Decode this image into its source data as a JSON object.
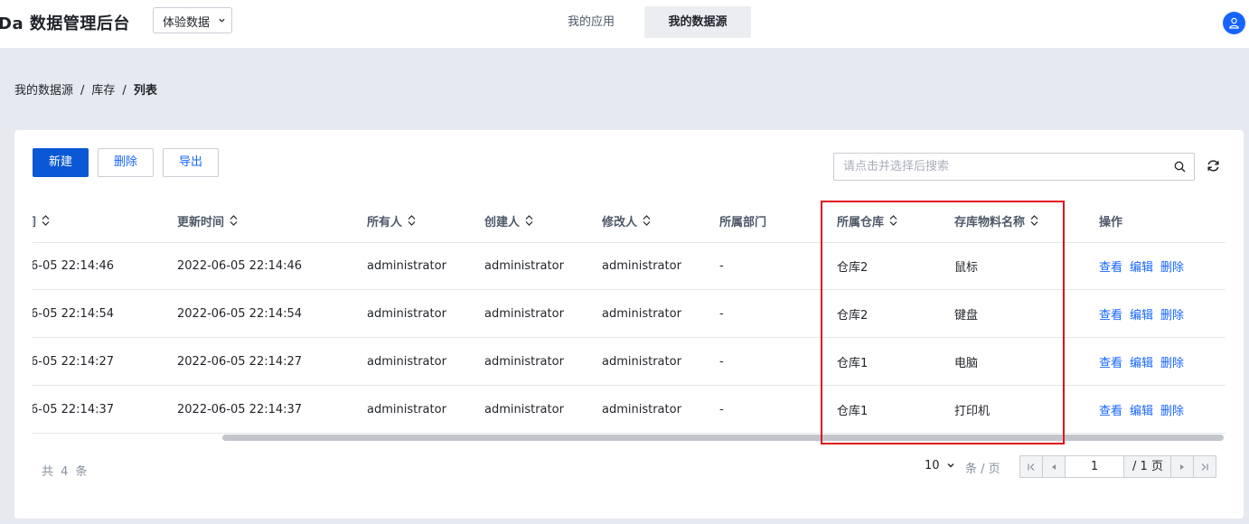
{
  "app": {
    "title": "Da 数据管理后台",
    "env_selected": "体验数据",
    "nav": [
      {
        "label": "我的应用",
        "active": false
      },
      {
        "label": "我的数据源",
        "active": true
      }
    ],
    "avatar_icon": "user-icon"
  },
  "breadcrumb": [
    "我的数据源",
    "库存",
    "列表"
  ],
  "breadcrumb_sep": "/",
  "toolbar": {
    "new_label": "新建",
    "delete_label": "删除",
    "export_label": "导出"
  },
  "search": {
    "placeholder": "请点击并选择后搜索"
  },
  "table": {
    "columns": [
      "间",
      "更新时间",
      "所有人",
      "创建人",
      "修改人",
      "所属部门",
      "所属仓库",
      "存库物料名称",
      "操作"
    ],
    "rows": [
      {
        "created": "6-05 22:14:46",
        "updated": "2022-06-05 22:14:46",
        "owner": "administrator",
        "creator": "administrator",
        "modifier": "administrator",
        "dept": "-",
        "warehouse": "仓库2",
        "material": "鼠标"
      },
      {
        "created": "6-05 22:14:54",
        "updated": "2022-06-05 22:14:54",
        "owner": "administrator",
        "creator": "administrator",
        "modifier": "administrator",
        "dept": "-",
        "warehouse": "仓库2",
        "material": "键盘"
      },
      {
        "created": "6-05 22:14:27",
        "updated": "2022-06-05 22:14:27",
        "owner": "administrator",
        "creator": "administrator",
        "modifier": "administrator",
        "dept": "-",
        "warehouse": "仓库1",
        "material": "电脑"
      },
      {
        "created": "6-05 22:14:37",
        "updated": "2022-06-05 22:14:37",
        "owner": "administrator",
        "creator": "administrator",
        "modifier": "administrator",
        "dept": "-",
        "warehouse": "仓库1",
        "material": "打印机"
      }
    ],
    "actions": [
      "查看",
      "编辑",
      "删除"
    ]
  },
  "footer": {
    "total": "共 4 条",
    "page_size": "10",
    "per_page_label": "条 / 页",
    "current_page": "1",
    "total_pages": "/ 1 页"
  },
  "colors": {
    "primary": "#0a58d6",
    "link": "#1664ff",
    "highlight": "#e0131d"
  }
}
